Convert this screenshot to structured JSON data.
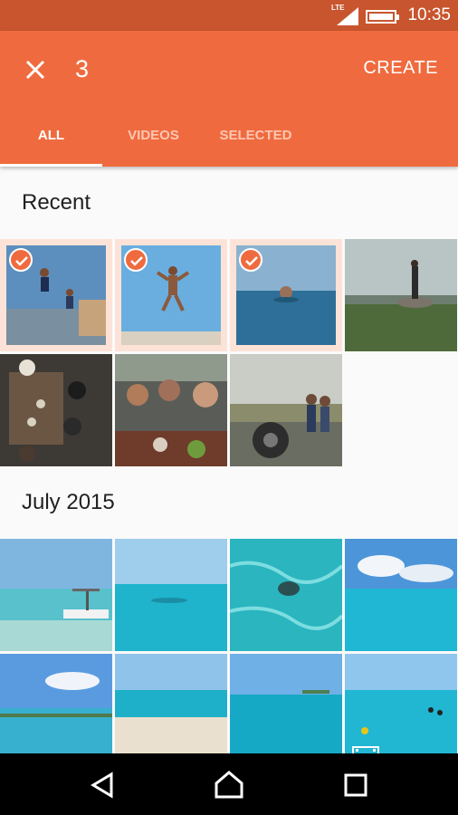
{
  "status": {
    "network": "LTE",
    "time": "10:35"
  },
  "header": {
    "count": "3",
    "create_label": "CREATE"
  },
  "tabs": [
    {
      "label": "ALL",
      "active": true
    },
    {
      "label": "VIDEOS",
      "active": false
    },
    {
      "label": "SELECTED",
      "active": false
    }
  ],
  "sections": {
    "recent": "Recent",
    "july": "July 2015"
  },
  "colors": {
    "accent": "#ef6b3f",
    "status_bar": "#c8552e",
    "selected_bg": "#fde3d7"
  },
  "recent_photos": [
    {
      "name": "photo-kids-jumping-pier",
      "selected": true
    },
    {
      "name": "photo-boy-jumping-sky",
      "selected": true
    },
    {
      "name": "photo-swimmer-sea",
      "selected": true
    },
    {
      "name": "photo-man-on-rock",
      "selected": false
    },
    {
      "name": "photo-friends-dinner-overhead",
      "selected": false
    },
    {
      "name": "photo-friends-dinner-selfie",
      "selected": false
    },
    {
      "name": "photo-couple-jeep-tire",
      "selected": false
    }
  ],
  "july_photos": [
    {
      "name": "photo-boat-shore"
    },
    {
      "name": "photo-turquoise-sea"
    },
    {
      "name": "photo-turtle-underwater"
    },
    {
      "name": "photo-sea-clouds"
    },
    {
      "name": "photo-beach-clouds"
    },
    {
      "name": "photo-beach-surfboards"
    },
    {
      "name": "photo-sea-horizon"
    },
    {
      "name": "video-swimmers-sea",
      "video": true
    }
  ]
}
